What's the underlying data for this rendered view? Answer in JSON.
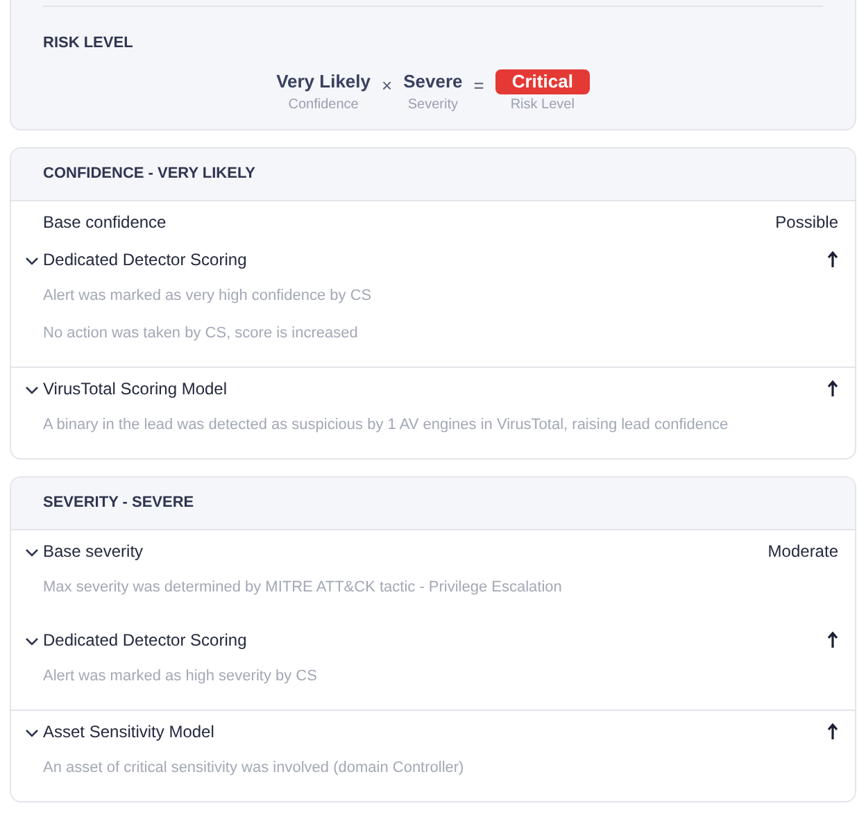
{
  "risk_level": {
    "title": "RISK LEVEL",
    "equation": [
      {
        "kind": "term",
        "value": "Very Likely",
        "caption": "Confidence"
      },
      {
        "kind": "operator",
        "symbol": "×"
      },
      {
        "kind": "term",
        "value": "Severe",
        "caption": "Severity"
      },
      {
        "kind": "operator",
        "symbol": "="
      },
      {
        "kind": "badge",
        "value": "Critical",
        "caption": "Risk Level"
      }
    ]
  },
  "sections": [
    {
      "title": "CONFIDENCE - VERY LIKELY",
      "groups": [
        {
          "items": [
            {
              "label": "Base confidence",
              "expandable": false,
              "rising": false,
              "value": "Possible"
            },
            {
              "label": "Dedicated Detector Scoring",
              "expandable": true,
              "rising": true,
              "details": [
                "Alert was marked as very high confidence by CS",
                "No action was taken by CS, score is increased"
              ]
            }
          ]
        },
        {
          "items": [
            {
              "label": "VirusTotal Scoring Model",
              "expandable": true,
              "rising": true,
              "details": [
                "A binary in the lead was detected as suspicious by 1 AV engines in VirusTotal, raising lead confidence"
              ]
            }
          ]
        }
      ]
    },
    {
      "title": "SEVERITY - SEVERE",
      "groups": [
        {
          "items": [
            {
              "label": "Base severity",
              "expandable": true,
              "rising": false,
              "value": "Moderate",
              "details": [
                "Max severity was determined by MITRE ATT&CK tactic - Privilege Escalation"
              ]
            },
            {
              "label": "Dedicated Detector Scoring",
              "expandable": true,
              "rising": true,
              "details": [
                "Alert was marked as high severity by CS"
              ]
            }
          ]
        },
        {
          "items": [
            {
              "label": "Asset Sensitivity Model",
              "expandable": true,
              "rising": true,
              "details": [
                "An asset of critical sensitivity was involved (domain Controller)"
              ]
            }
          ]
        }
      ]
    }
  ]
}
